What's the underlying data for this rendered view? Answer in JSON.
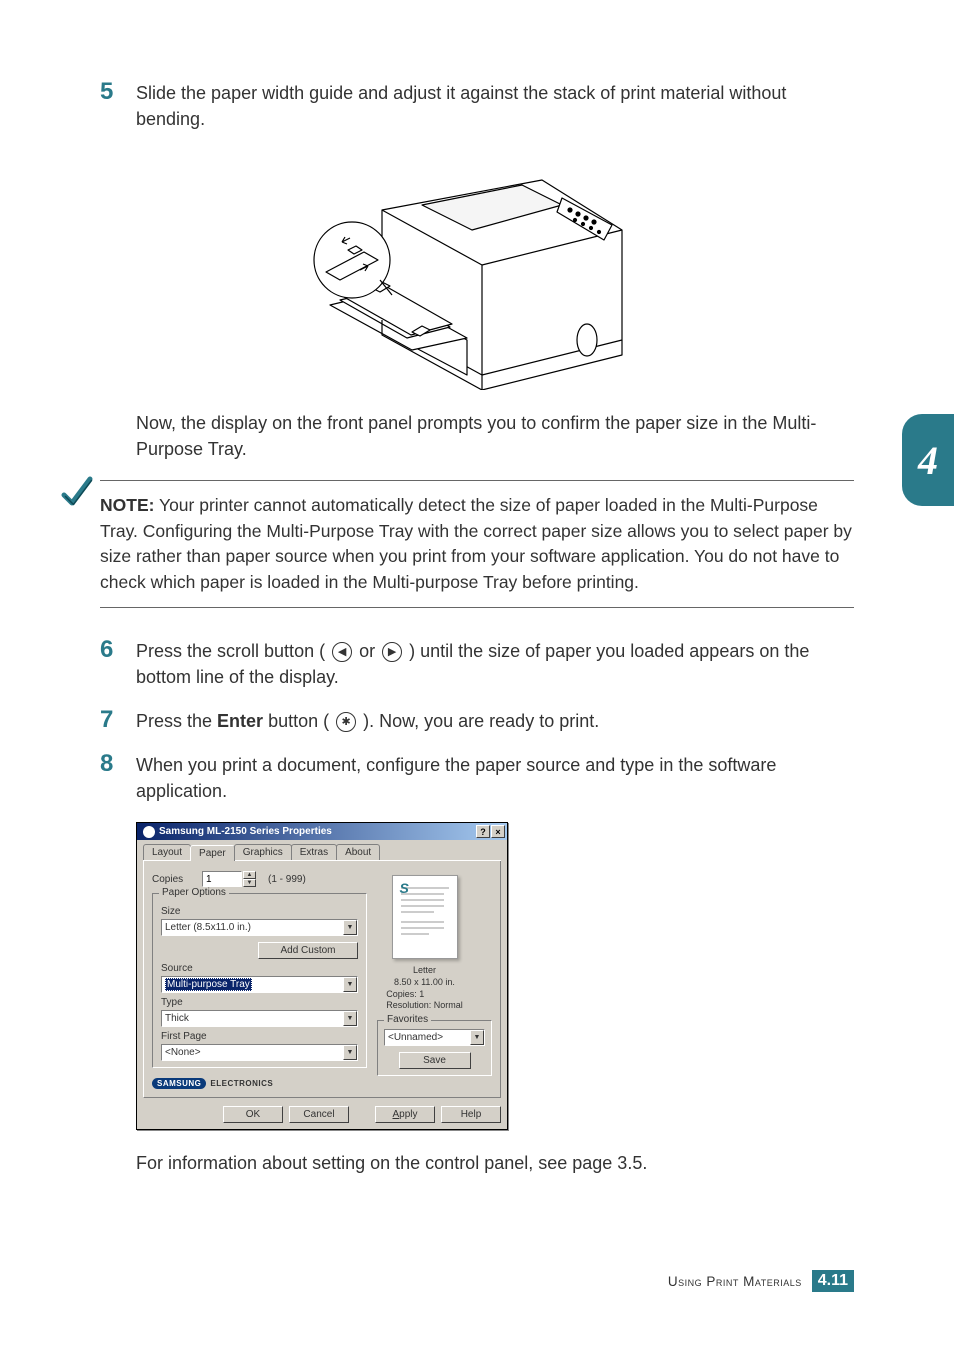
{
  "chapter_tab": "4",
  "steps": {
    "s5": {
      "num": "5",
      "text": "Slide the paper width guide and adjust it against the stack of print material without bending."
    },
    "s5_follow": "Now, the display on the front panel prompts you to confirm the paper size in the Multi-Purpose Tray.",
    "note_label": "NOTE:",
    "note_text": " Your printer cannot automatically detect the size of paper loaded in the Multi-Purpose Tray. Configuring the Multi-Purpose Tray with the correct paper size allows you to select paper by size rather than paper source when you print from your software application. You do not have to check which paper is loaded in the Multi-purpose Tray before printing.",
    "s6": {
      "num": "6",
      "pre": "Press the scroll button ( ",
      "mid": " or ",
      "post": " ) until the size of paper you loaded appears on the bottom line of the display."
    },
    "s7": {
      "num": "7",
      "pre": "Press the ",
      "bold": "Enter",
      "mid": " button ( ",
      "post": " ). Now, you are ready to print."
    },
    "s8": {
      "num": "8",
      "text": "When you print a document, configure the paper source and type in the software application."
    },
    "s8_follow": "For information about setting on the control panel, see page 3.5."
  },
  "dialog": {
    "title": "Samsung ML-2150 Series Properties",
    "tabs": [
      "Layout",
      "Paper",
      "Graphics",
      "Extras",
      "About"
    ],
    "copies_label": "Copies",
    "copies_value": "1",
    "copies_range": "(1 - 999)",
    "paper_options_title": "Paper Options",
    "size_label": "Size",
    "size_value": "Letter (8.5x11.0 in.)",
    "add_custom": "Add Custom",
    "source_label": "Source",
    "source_value": "Multi-purpose Tray",
    "type_label": "Type",
    "type_value": "Thick",
    "firstpage_label": "First Page",
    "firstpage_value": "<None>",
    "preview_format": "Letter",
    "preview_dims": "8.50 x 11.00 in.",
    "preview_copies": "Copies: 1",
    "preview_res": "Resolution: Normal",
    "favorites_title": "Favorites",
    "favorites_value": "<Unnamed>",
    "save": "Save",
    "logo": "SAMSUNG",
    "logo_sub": "ELECTRONICS",
    "ok": "OK",
    "cancel": "Cancel",
    "apply": "Apply",
    "help": "Help"
  },
  "footer": {
    "text": "Using Print Materials",
    "chapter": "4.",
    "page": "11"
  }
}
